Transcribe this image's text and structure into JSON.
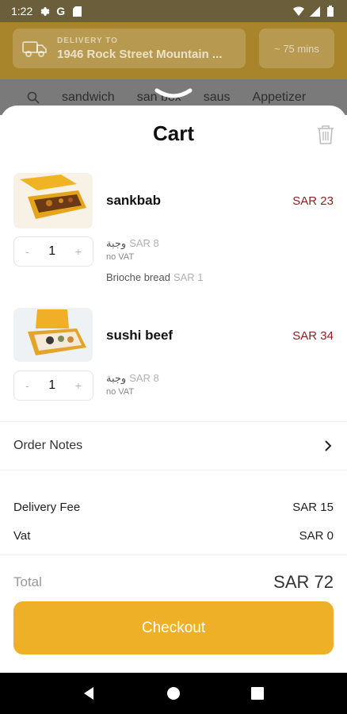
{
  "status": {
    "time": "1:22",
    "g_letter": "G"
  },
  "header": {
    "delivery_label": "DELIVERY TO",
    "address": "1946 Rock Street Mountain ...",
    "eta": "~ 75 mins"
  },
  "categories": [
    "sandwich",
    "san box",
    "saus",
    "Appetizer"
  ],
  "cart": {
    "title": "Cart",
    "items": [
      {
        "name": "sankbab",
        "price": "SAR 23",
        "qty": "1",
        "addons": [
          {
            "name": "وجبة",
            "price": "SAR 8",
            "sub": "no VAT"
          },
          {
            "name": "Brioche bread",
            "price": "SAR 1"
          }
        ]
      },
      {
        "name": "sushi beef",
        "price": "SAR 34",
        "qty": "1",
        "addons": [
          {
            "name": "وجبة",
            "price": "SAR 8",
            "sub": "no VAT"
          }
        ]
      }
    ],
    "minus": "-",
    "plus": "+",
    "order_notes": "Order Notes",
    "delivery_fee_label": "Delivery Fee",
    "delivery_fee": "SAR 15",
    "vat_label": "Vat",
    "vat": "SAR 0",
    "total_label": "Total",
    "total": "SAR 72",
    "checkout": "Checkout"
  },
  "colors": {
    "accent": "#eeb027",
    "price": "#8b1e1e"
  }
}
